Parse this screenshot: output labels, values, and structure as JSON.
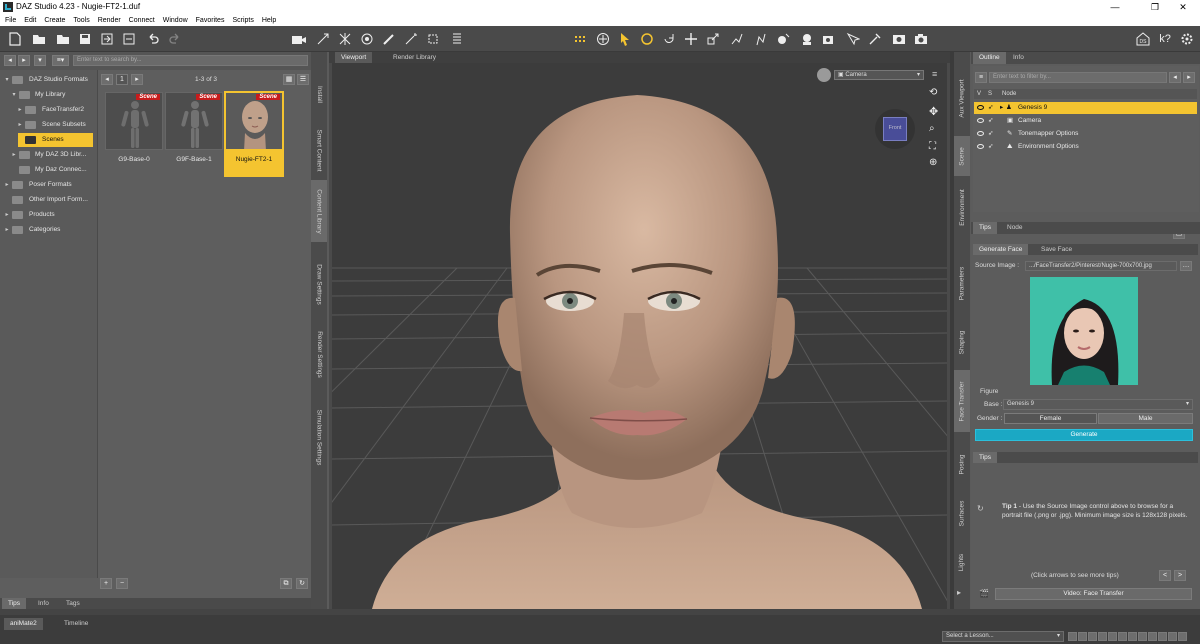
{
  "window": {
    "title": "DAZ Studio 4.23 - Nugie-FT2-1.duf",
    "controls": [
      "—",
      "❐",
      "✕"
    ]
  },
  "menu": [
    "File",
    "Edit",
    "Create",
    "Tools",
    "Render",
    "Connect",
    "Window",
    "Favorites",
    "Scripts",
    "Help"
  ],
  "left": {
    "filter_placeholder": "Enter text to search by...",
    "page_count": "1-3 of 3",
    "page_number": "1",
    "tree": [
      {
        "label": "DAZ Studio Formats",
        "indent": 0,
        "expanded": true
      },
      {
        "label": "My Library",
        "indent": 1,
        "expanded": true
      },
      {
        "label": "FaceTransfer2",
        "indent": 2,
        "expanded": false
      },
      {
        "label": "Scene Subsets",
        "indent": 2,
        "expanded": false
      },
      {
        "label": "Scenes",
        "indent": 2,
        "selected": true
      },
      {
        "label": "My DAZ 3D Libr...",
        "indent": 1,
        "expanded": false
      },
      {
        "label": "My Daz Connec...",
        "indent": 1
      },
      {
        "label": "Poser Formats",
        "indent": 0,
        "expanded": false
      },
      {
        "label": "Other Import Form...",
        "indent": 0
      },
      {
        "label": "Products",
        "indent": 0,
        "expanded": false
      },
      {
        "label": "Categories",
        "indent": 0,
        "expanded": false
      }
    ],
    "items": [
      {
        "label": "G9-Base-0",
        "badge": "Scene"
      },
      {
        "label": "G9F-Base-1",
        "badge": "Scene"
      },
      {
        "label": "Nugie-FT2-1",
        "badge": "Scene",
        "selected": true
      }
    ],
    "bottom_buttons": [
      "+",
      "−"
    ],
    "tabs": [
      "Tips",
      "Info",
      "Tags"
    ]
  },
  "left_vtabs": [
    "Install",
    "Smart Content",
    "Content Library",
    "Draw Settings",
    "Render Settings",
    "Simulation Settings"
  ],
  "viewport": {
    "tabs": [
      "Viewport",
      "Render Library"
    ],
    "camera": "Camera",
    "cube_label": "Front"
  },
  "right_vtabs_top": [
    "Aux Viewport",
    "Scene",
    "Environment"
  ],
  "right_vtabs_bottom": [
    "Parameters",
    "Shaping",
    "Face Transfer",
    "Posing",
    "Surfaces",
    "Lights"
  ],
  "outline": {
    "tabs": [
      "Outline",
      "Info"
    ],
    "filter_placeholder": "Enter text to filter by...",
    "columns": [
      "V",
      "S",
      "Node"
    ],
    "nodes": [
      {
        "label": "Genesis 9",
        "selected": true
      },
      {
        "label": "Camera"
      },
      {
        "label": "Tonemapper Options"
      },
      {
        "label": "Environment Options"
      }
    ],
    "bottom_tabs": [
      "Tips",
      "Node"
    ]
  },
  "face_transfer": {
    "tabs": [
      "Generate Face",
      "Save Face"
    ],
    "source_label": "Source Image :",
    "source_path": ".../FaceTransfer2/Pinterest/Nugie-700x700.jpg",
    "figure_label": "Figure",
    "base_label": "Base :",
    "base_value": "Genesis 9",
    "gender_label": "Gender :",
    "gender_options": [
      "Female",
      "Male"
    ],
    "generate": "Generate",
    "tips_tab": "Tips",
    "tip_bold": "Tip 1",
    "tip_text": " - Use the Source Image control above to browse for a portrait file (.png or .jpg). Minimum image size is 128x128 pixels.",
    "arrows_hint": "(Click arrows to see more tips)",
    "video_button": "Video: Face Transfer"
  },
  "bottom": {
    "tabs": [
      "aniMate2",
      "Timeline"
    ],
    "lesson_placeholder": "Select a Lesson..."
  },
  "colors": {
    "accent": "#f4c430",
    "generate": "#1ba8c4",
    "scene_badge": "#c71b1b",
    "viewport_bg": "#3c3c3c"
  }
}
